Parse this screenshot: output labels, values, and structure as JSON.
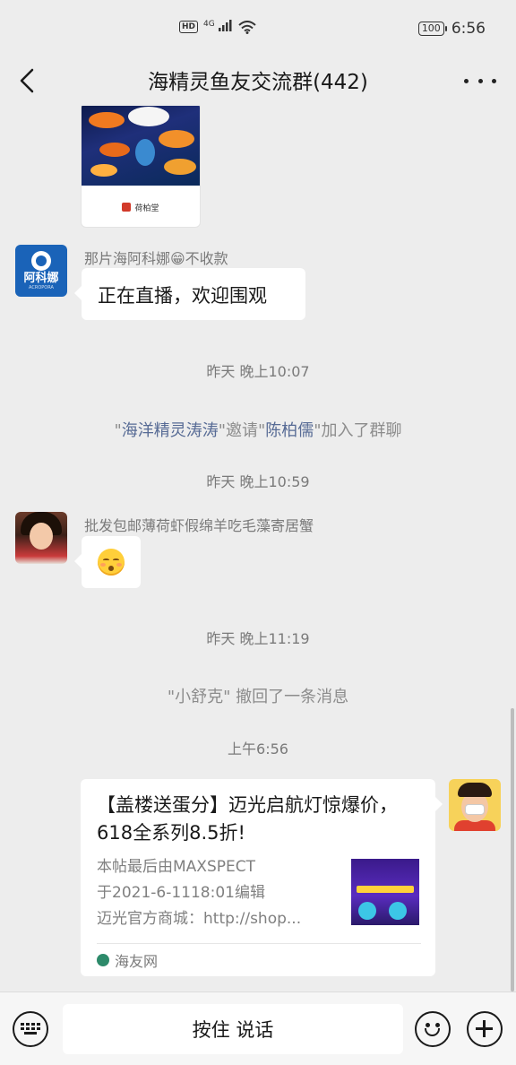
{
  "status_bar": {
    "hd": "HD",
    "network": "4G",
    "battery": "100",
    "time": "6:56"
  },
  "header": {
    "title": "海精灵鱼友交流群(442)"
  },
  "messages": {
    "image_caption": "荷柏堂",
    "msg1": {
      "sender": "那片海阿科娜😁不收款",
      "avatar_text": "阿科娜",
      "avatar_sub": "ACROPORA",
      "text": "正在直播，欢迎围观"
    },
    "time1": "昨天 晚上10:07",
    "system1": {
      "q1": "\"",
      "inviter": "海洋精灵涛涛",
      "mid": "\"邀请\"",
      "invitee": "陈柏儒",
      "end": "\"加入了群聊"
    },
    "time2": "昨天 晚上10:59",
    "msg2": {
      "sender": "批发包邮薄荷虾假绵羊吃毛藻寄居蟹"
    },
    "time3": "昨天 晚上11:19",
    "system2": "\"小舒克\" 撤回了一条消息",
    "time4": "上午6:56",
    "link": {
      "title": "【盖楼送蛋分】迈光启航灯惊爆价，618全系列8.5折!",
      "desc_line1": "本帖最后由MAXSPECT",
      "desc_line2": "于2021-6-1118:01编辑",
      "desc_line3": "迈光官方商城：http://shop...",
      "source": "海友网"
    }
  },
  "input_bar": {
    "hold_to_talk": "按住 说话"
  },
  "colors": {
    "background": "#ededed",
    "bubble": "#ffffff",
    "link_name": "#576b95",
    "muted_text": "#7a7a7a"
  }
}
